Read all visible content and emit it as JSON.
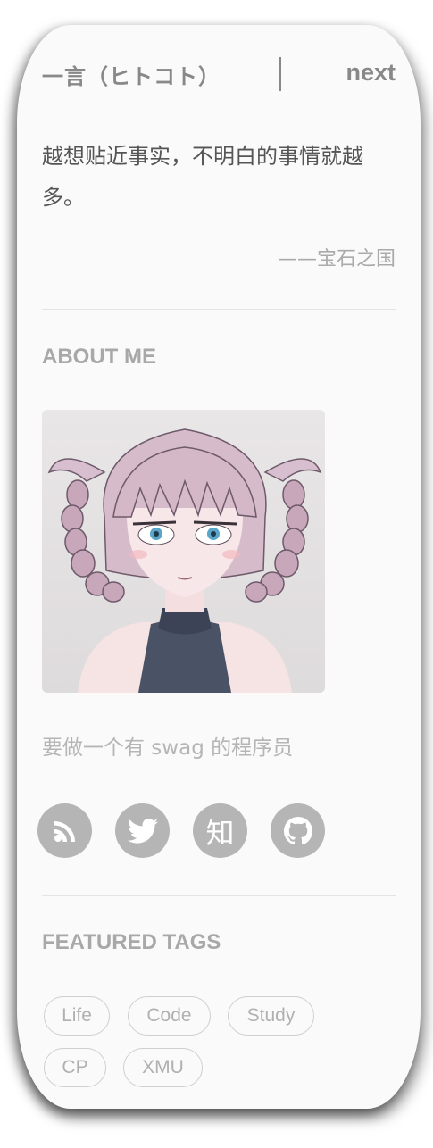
{
  "hitokoto": {
    "title": "一言（ヒトコト）",
    "next_label": "next",
    "quote": "越想贴近事实，不明白的事情就越多。",
    "source": "——宝石之国"
  },
  "about": {
    "title": "ABOUT ME",
    "avatar_alt": "avatar",
    "bio": "要做一个有 swag 的程序员",
    "social": [
      {
        "name": "rss-icon",
        "label": ""
      },
      {
        "name": "twitter-icon",
        "label": ""
      },
      {
        "name": "zhihu-icon",
        "label": "知"
      },
      {
        "name": "github-icon",
        "label": ""
      }
    ]
  },
  "featured_tags": {
    "title": "FEATURED TAGS",
    "tags": [
      "Life",
      "Code",
      "Study",
      "CP",
      "XMU"
    ]
  },
  "colors": {
    "card_bg": "#fafafa",
    "text_gray": "#888888",
    "icon_bg": "#b5b5b5"
  }
}
